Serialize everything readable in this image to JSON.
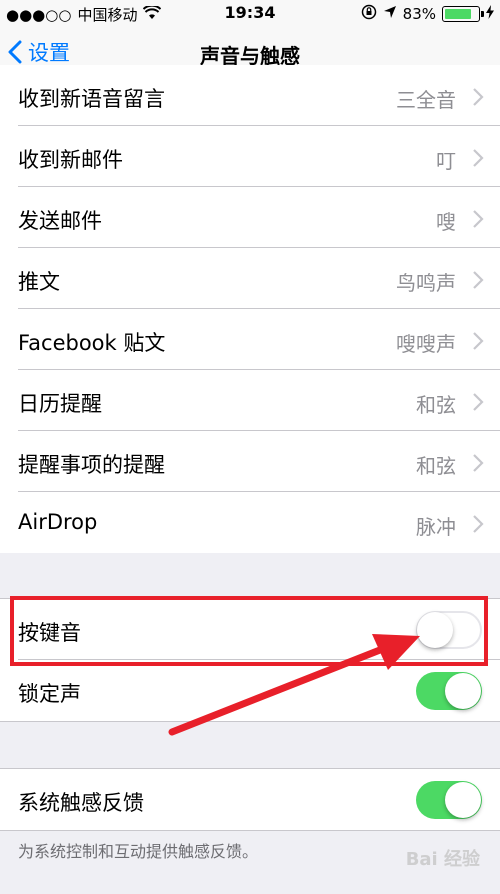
{
  "status_bar": {
    "signal": "●●●○○",
    "carrier": "中国移动",
    "time": "19:34",
    "battery": "83%",
    "battery_level": 0.83
  },
  "nav": {
    "back_label": "设置",
    "title": "声音与触感"
  },
  "sounds": [
    {
      "label": "收到新语音留言",
      "value": "三全音"
    },
    {
      "label": "收到新邮件",
      "value": "叮"
    },
    {
      "label": "发送邮件",
      "value": "嗖"
    },
    {
      "label": "推文",
      "value": "鸟鸣声"
    },
    {
      "label": "Facebook 贴文",
      "value": "嗖嗖声"
    },
    {
      "label": "日历提醒",
      "value": "和弦"
    },
    {
      "label": "提醒事项的提醒",
      "value": "和弦"
    },
    {
      "label": "AirDrop",
      "value": "脉冲"
    }
  ],
  "toggles": [
    {
      "label": "按键音",
      "on": false
    },
    {
      "label": "锁定声",
      "on": true
    }
  ],
  "haptics": {
    "label": "系统触感反馈",
    "on": true
  },
  "footer": "为系统控制和互动提供触感反馈。",
  "watermark": "Bai 经验",
  "colors": {
    "accent": "#007aff",
    "toggle_on": "#4cd964",
    "annotation": "#e8202a"
  }
}
